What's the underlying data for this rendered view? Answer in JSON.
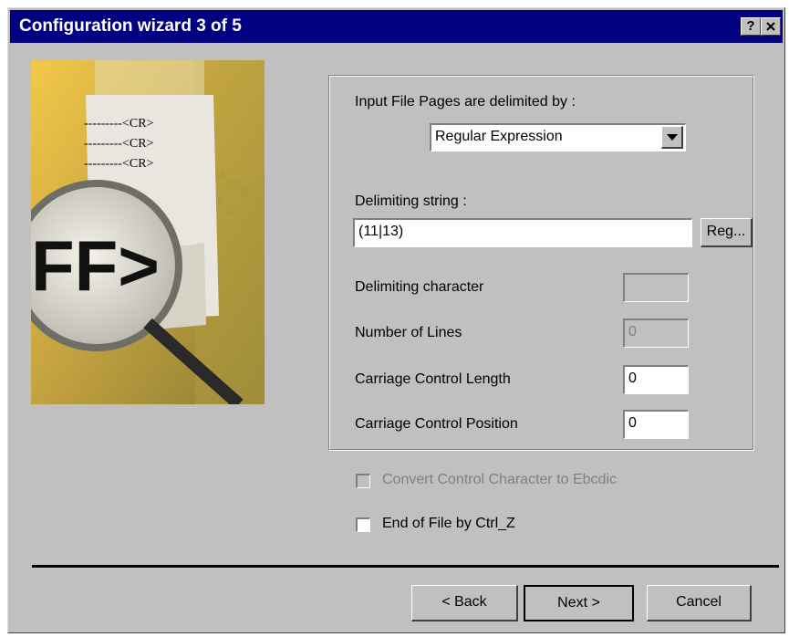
{
  "window": {
    "title": "Configuration wizard 3 of 5",
    "help_label": "?",
    "close_label": "✕"
  },
  "illustration": {
    "lines": [
      "---------<CR>",
      "---------<CR>",
      "---------<CR>"
    ],
    "big_text": "FF>"
  },
  "form": {
    "delimited_label": "Input File Pages are delimited by :",
    "delimited_value": "Regular Expression",
    "delimiting_string_label": "Delimiting string :",
    "delimiting_string_value": "(11|13)",
    "reg_button": "Reg...",
    "delimiting_char_label": "Delimiting character",
    "delimiting_char_value": "",
    "num_lines_label": "Number of Lines",
    "num_lines_value": "0",
    "cc_length_label": "Carriage Control Length",
    "cc_length_value": "0",
    "cc_position_label": "Carriage Control Position",
    "cc_position_value": "0"
  },
  "options": {
    "convert_label": "Convert Control Character to Ebcdic",
    "eof_label": "End of File by Ctrl_Z"
  },
  "buttons": {
    "back": "< Back",
    "next": "Next >",
    "cancel": "Cancel"
  }
}
